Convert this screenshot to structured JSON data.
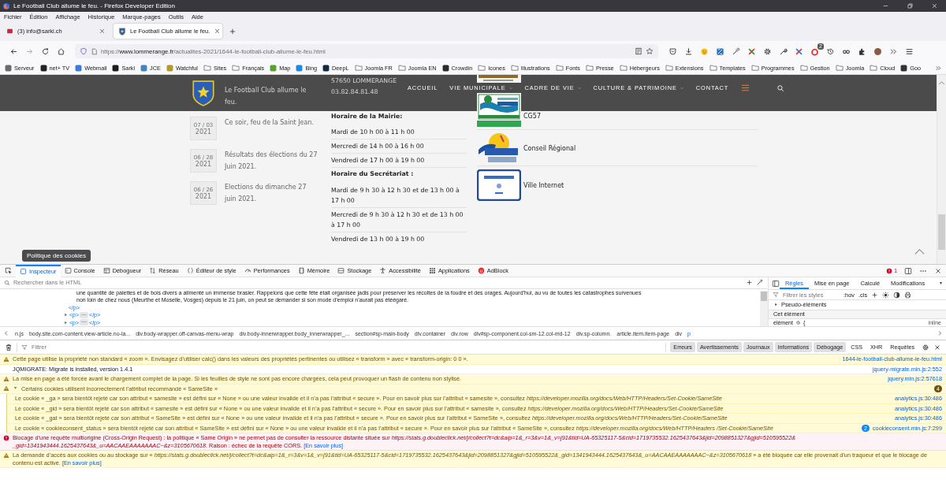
{
  "window": {
    "title": "Le Football Club allume le feu. - Firefox Developer Edition"
  },
  "menu": [
    "Fichier",
    "Édition",
    "Affichage",
    "Historique",
    "Marque-pages",
    "Outils",
    "Aide"
  ],
  "tabs": [
    {
      "label": "(3) info@sarki.ch",
      "selected": false
    },
    {
      "label": "Le Football Club allume le feu.",
      "selected": true
    }
  ],
  "address_bar": {
    "scheme": "https://",
    "host": "www.lommerange.fr",
    "path": "/actualites-2021/1644-le-football-club-allume-le-feu.html"
  },
  "toolbar": {
    "badge": "2"
  },
  "bookmarks": [
    {
      "label": "Serveur",
      "kind": "site"
    },
    {
      "label": "net+ TV",
      "kind": "site"
    },
    {
      "label": "Webmail",
      "kind": "site"
    },
    {
      "label": "Sarki",
      "kind": "site"
    },
    {
      "label": "JCE",
      "kind": "site"
    },
    {
      "label": "Watchful",
      "kind": "site"
    },
    {
      "label": "Sites",
      "kind": "folder"
    },
    {
      "label": "Français",
      "kind": "folder"
    },
    {
      "label": "Map",
      "kind": "site"
    },
    {
      "label": "Bing",
      "kind": "site"
    },
    {
      "label": "DeepL",
      "kind": "site"
    },
    {
      "label": "Joomla FR",
      "kind": "folder"
    },
    {
      "label": "Joomla EN",
      "kind": "folder"
    },
    {
      "label": "Crowdin",
      "kind": "site"
    },
    {
      "label": "Icones",
      "kind": "folder"
    },
    {
      "label": "Illustrations",
      "kind": "folder"
    },
    {
      "label": "Fonts",
      "kind": "folder"
    },
    {
      "label": "Presse",
      "kind": "folder"
    },
    {
      "label": "Hébergeurs",
      "kind": "folder"
    },
    {
      "label": "Extensions",
      "kind": "folder"
    },
    {
      "label": "Templates",
      "kind": "folder"
    },
    {
      "label": "Programmes",
      "kind": "folder"
    },
    {
      "label": "Gestion",
      "kind": "folder"
    },
    {
      "label": "Joomla",
      "kind": "folder"
    },
    {
      "label": "Cloud",
      "kind": "folder"
    },
    {
      "label": "Goo",
      "kind": "site"
    }
  ],
  "page": {
    "nav": [
      {
        "label": "ACCUEIL",
        "dropdown": false
      },
      {
        "label": "VIE MUNICIPALE",
        "dropdown": true
      },
      {
        "label": "CADRE DE VIE",
        "dropdown": true
      },
      {
        "label": "CULTURE & PATRIMOINE",
        "dropdown": true
      },
      {
        "label": "CONTACT",
        "dropdown": false
      }
    ],
    "news": [
      {
        "title": "Le Football Club allume le feu."
      },
      {
        "date": "07 / 03",
        "year": "2021",
        "title": "Ce soir, feu de la Saint Jean."
      },
      {
        "date": "06 / 28",
        "year": "2021",
        "title": "Résultats des élections du 27 Juin 2021."
      },
      {
        "date": "06 / 26",
        "year": "2021",
        "title": "Elections du dimanche 27 juin 2021."
      }
    ],
    "address": [
      "57650 LOMMERANGE",
      "03.82.84.81.48"
    ],
    "hours": [
      {
        "kind": "heading",
        "text": "Horaire de la Mairie:"
      },
      {
        "kind": "line",
        "text": "Mardi de 10 h 00 à 11 h 00"
      },
      {
        "kind": "line",
        "text": "Mercredi de 14 h 00 à 16 h 00"
      },
      {
        "kind": "line",
        "text": "Vendredi de 17 h 00 à 19 h 00"
      },
      {
        "kind": "heading",
        "text": "Horaire du Secrétariat :"
      },
      {
        "kind": "line",
        "text": "Mardi de 9 h 30 à 12 h 30 et de 13 h 00 à 17 h 00"
      },
      {
        "kind": "line",
        "text": "Mercredi de 9 h 30 à 12 h 30 et de 13 h 00 à 17 h 00"
      },
      {
        "kind": "line",
        "text": "Vendredi de 13 h 00 à 19 h 00"
      }
    ],
    "partners": [
      {
        "kind": "logo"
      },
      {
        "kind": "logo",
        "label": "CG57"
      },
      {
        "kind": "logo",
        "label": "Conseil Régional"
      },
      {
        "kind": "logo",
        "label": "Ville Internet"
      }
    ]
  },
  "devtools": {
    "tooltip": "Politique des cookies",
    "tabs": [
      {
        "label": "Inspecteur",
        "selected": true
      },
      {
        "label": "Console",
        "selected": false
      },
      {
        "label": "Débogueur",
        "selected": false
      },
      {
        "label": "Réseau",
        "selected": false
      },
      {
        "label": "Éditeur de style",
        "selected": false
      },
      {
        "label": "Performances",
        "selected": false
      },
      {
        "label": "Mémoire",
        "selected": false
      },
      {
        "label": "Stockage",
        "selected": false
      },
      {
        "label": "Accessibilité",
        "selected": false
      },
      {
        "label": "Applications",
        "selected": false
      },
      {
        "label": "AdBlock",
        "selected": false
      }
    ],
    "error_count": "1",
    "markup": {
      "search_placeholder": "Rechercher dans le HTML",
      "lines": [
        {
          "kind": "text",
          "text": "une quantité de palettes et de bois divers a alimenté un immense brasier. Rappelons que cette fête était organisée jadis pour préserver les récoltes de la foudre et des orages. Aujourd’hui, au vu de toutes les catastrophes survenues"
        },
        {
          "kind": "text",
          "text": "non loin de chez nous (Meurthe et Moselle, Vosges) depuis le 21 juin, on peut se demander si son mode d’emploi n’aurait pas étéégaré."
        },
        {
          "kind": "close",
          "text": "</p>"
        },
        {
          "kind": "node",
          "open": "<p>",
          "badge": "⋯",
          "close": "</p>",
          "expanded": false
        },
        {
          "kind": "node",
          "open": "<p>",
          "badge": "⋯",
          "close": "</p>",
          "expanded": false
        }
      ]
    },
    "breadcrumbs": [
      {
        "label": "n.js",
        "selected": false
      },
      {
        "label": "body.site.com-content.view-article.no-la...",
        "selected": false
      },
      {
        "label": "div.body-wrapper.off-canvas-menu-wrap",
        "selected": false
      },
      {
        "label": "div.body-innerwrapper.body_innerwrapper_...",
        "selected": false
      },
      {
        "label": "section#sp-main-body",
        "selected": false
      },
      {
        "label": "div.container",
        "selected": false
      },
      {
        "label": "div.row",
        "selected": false
      },
      {
        "label": "div#sp-component.col-sm-12.col-md-12",
        "selected": false
      },
      {
        "label": "div.sp-column.",
        "selected": false
      },
      {
        "label": "article.item.item-page",
        "selected": false
      },
      {
        "label": "div",
        "selected": false
      },
      {
        "label": "p",
        "selected": true
      }
    ],
    "rules": {
      "tabs": [
        {
          "label": "Règles",
          "selected": true
        },
        {
          "label": "Mise en page",
          "selected": false
        },
        {
          "label": "Calculé",
          "selected": false
        },
        {
          "label": "Modifications",
          "selected": false
        }
      ],
      "filter_placeholder": "Filtrer les styles",
      "toggles": [
        ":hov",
        ".cls"
      ],
      "sections": [
        {
          "kind": "toggle",
          "label": "Pseudo-éléments",
          "expanded": false
        },
        {
          "kind": "header",
          "label": "Cet élément"
        }
      ],
      "rule": {
        "selector": "élément",
        "open": "{",
        "source": "inline"
      }
    },
    "console": {
      "filter_placeholder": "Filtrer",
      "levels": [
        {
          "label": "Erreurs",
          "on": true
        },
        {
          "label": "Avertissements",
          "on": true
        },
        {
          "label": "Journaux",
          "on": true
        },
        {
          "label": "Informations",
          "on": true
        },
        {
          "label": "Débogage",
          "on": true
        },
        {
          "label": "CSS",
          "on": false
        },
        {
          "label": "XHR",
          "on": false
        },
        {
          "label": "Requêtes",
          "on": false
        }
      ],
      "messages": [
        {
          "kind": "warning",
          "text": "Cette page utilise la propriété non standard « zoom ». Envisagez d’utiliser calc() dans les valeurs des propriétés pertinentes ou utilisez « transform » avec « transform-origin: 0 0 ».",
          "source": "1644-le-football-club-allume-le-feu.html"
        },
        {
          "kind": "log",
          "text": "JQMIGRATE: Migrate is installed, version 1.4.1",
          "source": "jquery-migrate.min.js:2:552"
        },
        {
          "kind": "warning",
          "text": "La mise en page a été forcée avant le chargement complet de la page. Si les feuilles de style ne sont pas encore chargées, cela peut provoquer un flash de contenu non stylisé.",
          "source": "jquery.min.js:2:57618"
        },
        {
          "kind": "group",
          "text": "Certains cookies utilisent incorrectement l’attribut recommandé « SameSite »",
          "count": "4",
          "expanded": true,
          "children": [
            {
              "kind": "warning",
              "text": "Le cookie « _ga » sera bientôt rejeté car son attribut « samesite » est défini sur « None » ou une valeur invalide et il n’a pas l’attribut « secure ». Pour en savoir plus sur l’attribut « samesite », consultez *https://developer.mozilla.org/docs/Web/HTTP/Headers/Set-Cookie/SameSite*",
              "source": "analytics.js:30:486"
            },
            {
              "kind": "warning",
              "text": "Le cookie « _gid » sera bientôt rejeté car son attribut « samesite » est défini sur « None » ou une valeur invalide et il n’a pas l’attribut « secure ». Pour en savoir plus sur l’attribut « samesite », consultez *https://developer.mozilla.org/docs/Web/HTTP/Headers/Set-Cookie/SameSite*",
              "source": "analytics.js:30:486"
            },
            {
              "kind": "warning",
              "text": "Le cookie « _gat » sera bientôt rejeté car son attribut « SameSite » est défini sur « None » ou une valeur invalide et il n’a pas l’attribut « secure ». Pour en savoir plus sur l’attribut « SameSite », consultez *https://developer.mozilla.org/docs/Web/HTTP/Headers/Set-Cookie/SameSite*",
              "source": "analytics.js:30:486"
            },
            {
              "kind": "warning",
              "text": "Le cookie « cookieconsent_status » sera bientôt rejeté car son attribut « SameSite » est défini sur « None » ou une valeur invalide et il n’a pas l’attribut « secure ». Pour en savoir plus sur l’attribut « SameSite », consultez *https://developer.mozilla.org/docs/Web/HTTP/Headers /Set-Cookie/SameSite*",
              "repeat": "2",
              "source": "cookieconsent.min.js:7:299"
            }
          ]
        },
        {
          "kind": "error",
          "text": "Blocage d’une requête multiorigine (Cross-Origin Request) : la politique « Same Origin » ne permet pas de consulter la ressource distante située sur *https://stats.g.doubleclick.net/j/collect?t=dc&aip=1&_r=3&v=1&_v=j91&tid=UA-65325117-5&cid=1719735532.1625437643&jid=2098851327&gjid=510595522& _gid=1341943444.1625437643&_u=AACAAEAAAAAAAC~&z=3105670618*. Raison : échec de la requête CORS.",
          "link": "[En savoir plus]"
        },
        {
          "kind": "warning",
          "text": "La demande d’accès aux cookies ou au stockage sur « *https://stats.g.doubleclick.net/j/collect?t=dc&aip=1&_r=3&v=1&_v=j91&tid=UA-65325117-5&cid=1719735532.1625437643&jid=2098851327&gjid=510595522&_gid=1341943444.1625437643&_u=AACAAEAAAAAAAC~&z=3105670618* » a été bloquée car elle provenait d’un traqueur et que le blocage de contenu est activé.",
          "link": "[En savoir plus]"
        }
      ]
    }
  }
}
